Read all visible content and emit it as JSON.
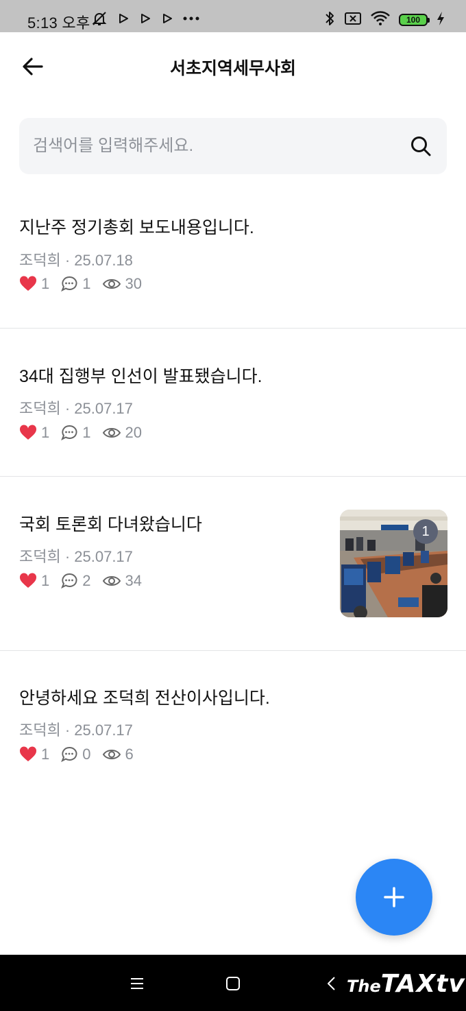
{
  "status_bar": {
    "time": "5:13 오후",
    "battery": "100",
    "icons": [
      "notifications-muted-icon",
      "play-icon",
      "play-icon",
      "play-icon",
      "more-dots-icon",
      "bluetooth-icon",
      "sim-icon",
      "wifi-icon",
      "battery-icon",
      "charging-icon"
    ]
  },
  "header": {
    "title": "서초지역세무사회",
    "back_icon": "arrow-left-icon"
  },
  "search": {
    "placeholder": "검색어를 입력해주세요.",
    "icon": "search-icon"
  },
  "posts": [
    {
      "title": "지난주 정기총회 보도내용입니다.",
      "meta": "조덕희 · 25.07.18",
      "likes": "1",
      "comments": "1",
      "views": "30",
      "has_thumbnail": false
    },
    {
      "title": "34대 집행부 인선이 발표됐습니다.",
      "meta": "조덕희 · 25.07.17",
      "likes": "1",
      "comments": "1",
      "views": "20",
      "has_thumbnail": false
    },
    {
      "title": "국회 토론회 다녀왔습니다",
      "meta": "조덕희 · 25.07.17",
      "likes": "1",
      "comments": "2",
      "views": "34",
      "has_thumbnail": true,
      "thumbnail_count": "1"
    },
    {
      "title": "안녕하세요 조덕희 전산이사입니다.",
      "meta": "조덕희 · 25.07.17",
      "likes": "1",
      "comments": "0",
      "views": "6",
      "has_thumbnail": false
    }
  ],
  "fab": {
    "icon": "plus-icon"
  },
  "nav_bar": {
    "icons": [
      "recent-apps-icon",
      "home-icon",
      "back-icon"
    ],
    "watermark_the": "The",
    "watermark_brand": "TAXtv"
  },
  "colors": {
    "accent": "#2b86f5",
    "heart": "#e8364a",
    "muted_text": "#8b8f96",
    "search_bg": "#f4f5f7",
    "divider": "#e3e4e6"
  }
}
